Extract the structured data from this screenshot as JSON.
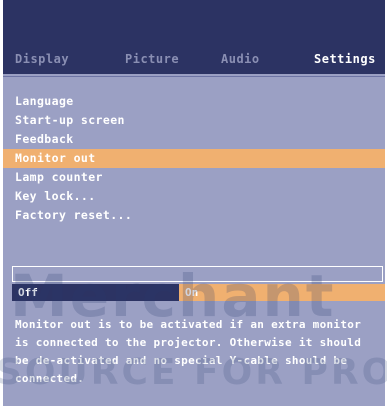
{
  "tabs": [
    {
      "label": "Display",
      "active": false
    },
    {
      "label": "Picture",
      "active": false
    },
    {
      "label": "Audio",
      "active": false
    },
    {
      "label": "Settings",
      "active": true
    }
  ],
  "menu": [
    {
      "label": "Language",
      "selected": false
    },
    {
      "label": "Start-up screen",
      "selected": false
    },
    {
      "label": "Feedback",
      "selected": false
    },
    {
      "label": "Monitor out",
      "selected": true
    },
    {
      "label": "Lamp counter",
      "selected": false
    },
    {
      "label": "Key lock...",
      "selected": false
    },
    {
      "label": "Factory reset...",
      "selected": false
    }
  ],
  "toggle": {
    "off_label": "Off",
    "on_label": "On",
    "selected": "On"
  },
  "help_text": "Monitor out is to be activated if an extra monitor is connected to the projector. Otherwise it should be de-activated and no special Y-cable should be connected.",
  "watermark": {
    "line1": "Merchant",
    "line2": "SOURCE FOR PRO"
  },
  "colors": {
    "header_bg": "#2c3363",
    "panel_bg": "#9ba0c4",
    "highlight": "#f0b070",
    "text": "#ffffff"
  }
}
